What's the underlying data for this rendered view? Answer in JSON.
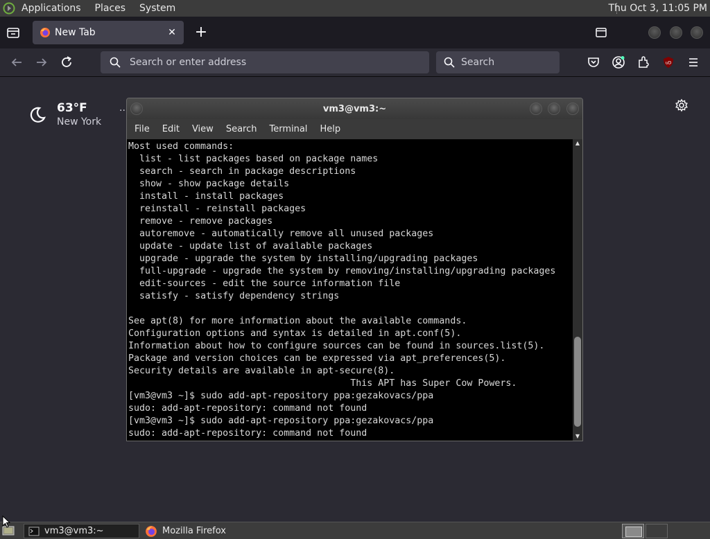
{
  "top_panel": {
    "menus": [
      "Applications",
      "Places",
      "System"
    ],
    "clock": "Thu Oct  3, 11:05 PM"
  },
  "browser": {
    "tab": {
      "title": "New Tab"
    },
    "urlbar": {
      "placeholder": "Search or enter address"
    },
    "searchbar": {
      "placeholder": "Search"
    }
  },
  "newtab": {
    "weather": {
      "temp": "63°F",
      "city": "New York",
      "more": ".."
    }
  },
  "terminal": {
    "title": "vm3@vm3:~",
    "menu": [
      "File",
      "Edit",
      "View",
      "Search",
      "Terminal",
      "Help"
    ],
    "lines": [
      "Most used commands:",
      "  list - list packages based on package names",
      "  search - search in package descriptions",
      "  show - show package details",
      "  install - install packages",
      "  reinstall - reinstall packages",
      "  remove - remove packages",
      "  autoremove - automatically remove all unused packages",
      "  update - update list of available packages",
      "  upgrade - upgrade the system by installing/upgrading packages",
      "  full-upgrade - upgrade the system by removing/installing/upgrading packages",
      "  edit-sources - edit the source information file",
      "  satisfy - satisfy dependency strings",
      "",
      "See apt(8) for more information about the available commands.",
      "Configuration options and syntax is detailed in apt.conf(5).",
      "Information about how to configure sources can be found in sources.list(5).",
      "Package and version choices can be expressed via apt_preferences(5).",
      "Security details are available in apt-secure(8).",
      "                                        This APT has Super Cow Powers.",
      "[vm3@vm3 ~]$ sudo add-apt-repository ppa:gezakovacs/ppa",
      "sudo: add-apt-repository: command not found",
      "[vm3@vm3 ~]$ sudo add-apt-repository ppa:gezakovacs/ppa",
      "sudo: add-apt-repository: command not found"
    ]
  },
  "taskbar": {
    "items": [
      {
        "label": "vm3@vm3:~"
      },
      {
        "label": "Mozilla Firefox"
      }
    ]
  },
  "colors": {
    "browser_bg": "#2b2a33",
    "tab_active": "#42414d",
    "terminal_bg": "#000000",
    "terminal_fg": "#d8d8d8",
    "panel": "#3c3c3c"
  }
}
